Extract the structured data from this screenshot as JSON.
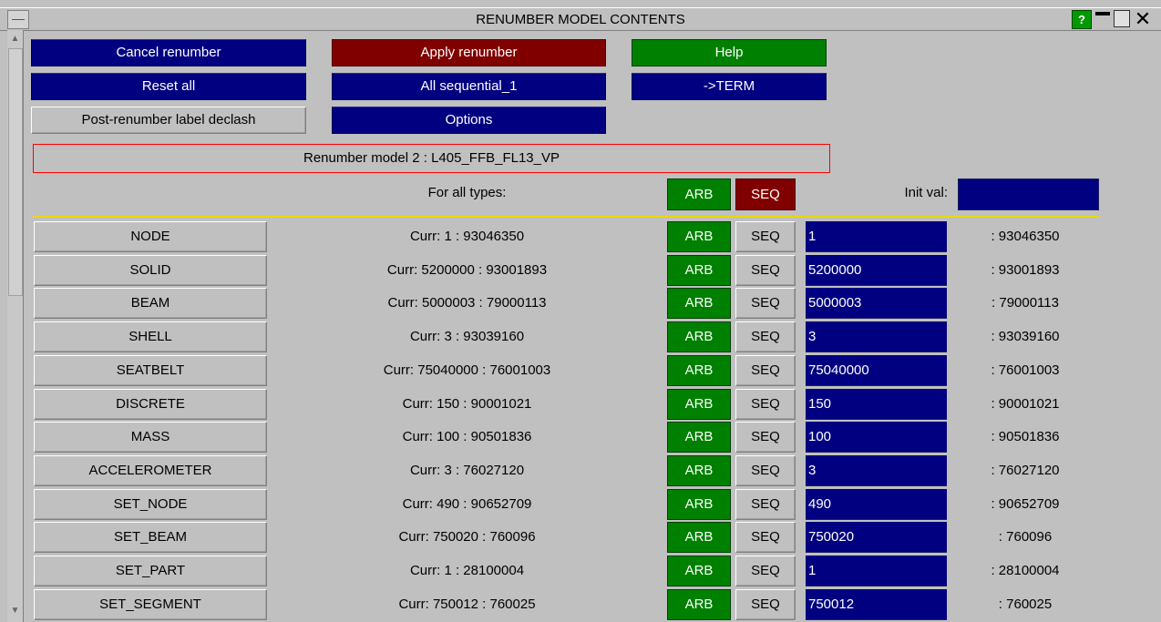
{
  "window": {
    "title": "RENUMBER MODEL CONTENTS",
    "help_label": "?"
  },
  "actions": {
    "cancel": "Cancel renumber",
    "apply": "Apply renumber",
    "help": "Help",
    "reset": "Reset all",
    "all_seq": "All sequential_1",
    "term": "->TERM",
    "declash": "Post-renumber label declash",
    "options": "Options"
  },
  "model_label": "Renumber model 2 : L405_FFB_FL13_VP",
  "for_all": {
    "label": "For all types:",
    "arb": "ARB",
    "seq": "SEQ",
    "init_label": "Init val:",
    "init_value": ""
  },
  "rows": [
    {
      "type": "NODE",
      "curr": "Curr: 1 : 93046350",
      "arb": "ARB",
      "seq": "SEQ",
      "start": "1",
      "end": ": 93046350"
    },
    {
      "type": "SOLID",
      "curr": "Curr: 5200000 : 93001893",
      "arb": "ARB",
      "seq": "SEQ",
      "start": "5200000",
      "end": ": 93001893"
    },
    {
      "type": "BEAM",
      "curr": "Curr: 5000003 : 79000113",
      "arb": "ARB",
      "seq": "SEQ",
      "start": "5000003",
      "end": ": 79000113"
    },
    {
      "type": "SHELL",
      "curr": "Curr: 3 : 93039160",
      "arb": "ARB",
      "seq": "SEQ",
      "start": "3",
      "end": ": 93039160"
    },
    {
      "type": "SEATBELT",
      "curr": "Curr: 75040000 : 76001003",
      "arb": "ARB",
      "seq": "SEQ",
      "start": "75040000",
      "end": ": 76001003"
    },
    {
      "type": "DISCRETE",
      "curr": "Curr: 150 : 90001021",
      "arb": "ARB",
      "seq": "SEQ",
      "start": "150",
      "end": ": 90001021"
    },
    {
      "type": "MASS",
      "curr": "Curr: 100 : 90501836",
      "arb": "ARB",
      "seq": "SEQ",
      "start": "100",
      "end": ": 90501836"
    },
    {
      "type": "ACCELEROMETER",
      "curr": "Curr: 3 : 76027120",
      "arb": "ARB",
      "seq": "SEQ",
      "start": "3",
      "end": ": 76027120"
    },
    {
      "type": "SET_NODE",
      "curr": "Curr: 490 : 90652709",
      "arb": "ARB",
      "seq": "SEQ",
      "start": "490",
      "end": ": 90652709"
    },
    {
      "type": "SET_BEAM",
      "curr": "Curr: 750020 : 760096",
      "arb": "ARB",
      "seq": "SEQ",
      "start": "750020",
      "end": ": 760096"
    },
    {
      "type": "SET_PART",
      "curr": "Curr: 1 : 28100004",
      "arb": "ARB",
      "seq": "SEQ",
      "start": "1",
      "end": ": 28100004"
    },
    {
      "type": "SET_SEGMENT",
      "curr": "Curr: 750012 : 760025",
      "arb": "ARB",
      "seq": "SEQ",
      "start": "750012",
      "end": ": 760025"
    }
  ]
}
